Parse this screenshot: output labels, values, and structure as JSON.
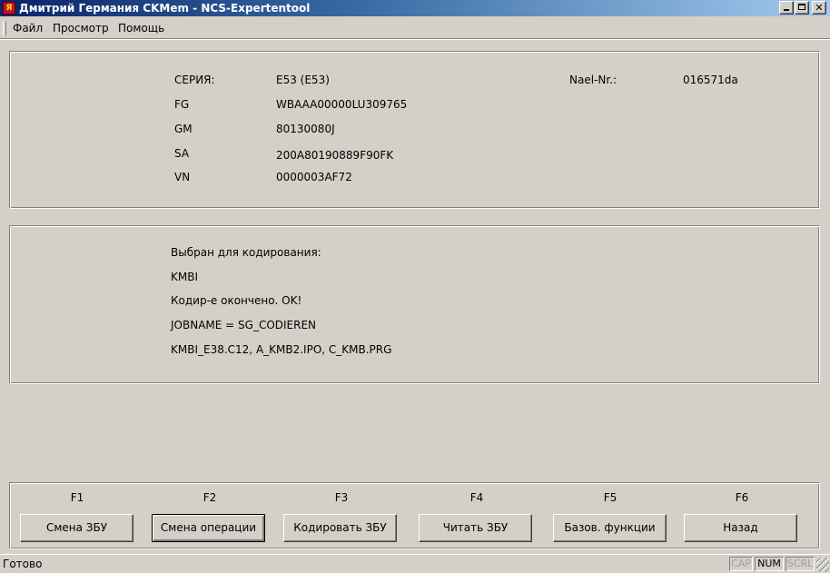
{
  "window": {
    "title": "Дмитрий Германия CKMem - NCS-Expertentool",
    "app_icon_glyph": "Я",
    "controls": {
      "minimize": "minimize-icon",
      "maximize": "maximize-icon",
      "close_glyph": "✕"
    }
  },
  "menu": {
    "items": [
      "Файл",
      "Просмотр",
      "Помощь"
    ]
  },
  "vehicle_info": {
    "series_label": "СЕРИЯ:",
    "series_value": "E53 (E53)",
    "nael_label": "Nael-Nr.:",
    "nael_value": "016571da",
    "fg_label": "FG",
    "fg_value": "WBAAA00000LU309765",
    "gm_label": "GM",
    "gm_value": "80130080J",
    "sa_label": "SA",
    "sa_value": "200A80190889F90FK",
    "vn_label": "VN",
    "vn_value": "0000003AF72"
  },
  "messages": [
    "Выбран для кодирования:",
    "KMBI",
    "Кодир-е окончено. OK!",
    "JOBNAME = SG_CODIEREN",
    "KMBI_E38.C12, A_KMB2.IPO, C_KMB.PRG"
  ],
  "function_keys": [
    {
      "key": "F1",
      "label": "Смена ЗБУ"
    },
    {
      "key": "F2",
      "label": "Смена операции"
    },
    {
      "key": "F3",
      "label": "Кодировать ЗБУ"
    },
    {
      "key": "F4",
      "label": "Читать ЗБУ"
    },
    {
      "key": "F5",
      "label": "Базов. функции"
    },
    {
      "key": "F6",
      "label": "Назад"
    }
  ],
  "status": {
    "text": "Готово",
    "indicators": {
      "cap": "CAP",
      "num": "NUM",
      "scrl": "SCRL"
    }
  }
}
